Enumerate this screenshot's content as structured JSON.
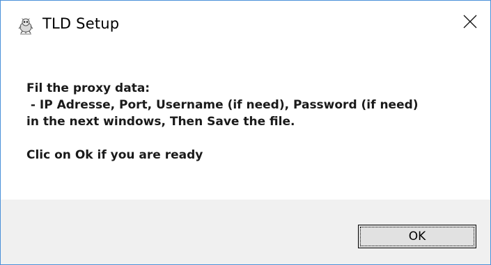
{
  "window": {
    "title": "TLD Setup",
    "app_icon": "raccoon-mascot-icon",
    "close_icon": "close-icon",
    "border_color": "#4a90d9"
  },
  "message": {
    "line1": "Fil the proxy data:",
    "line2": " - IP Adresse, Port, Username (if need), Password (if need)",
    "line3": "in the next windows, Then Save the file.",
    "line4": "Clic on Ok if you are ready"
  },
  "buttons": {
    "ok_label": "OK"
  }
}
